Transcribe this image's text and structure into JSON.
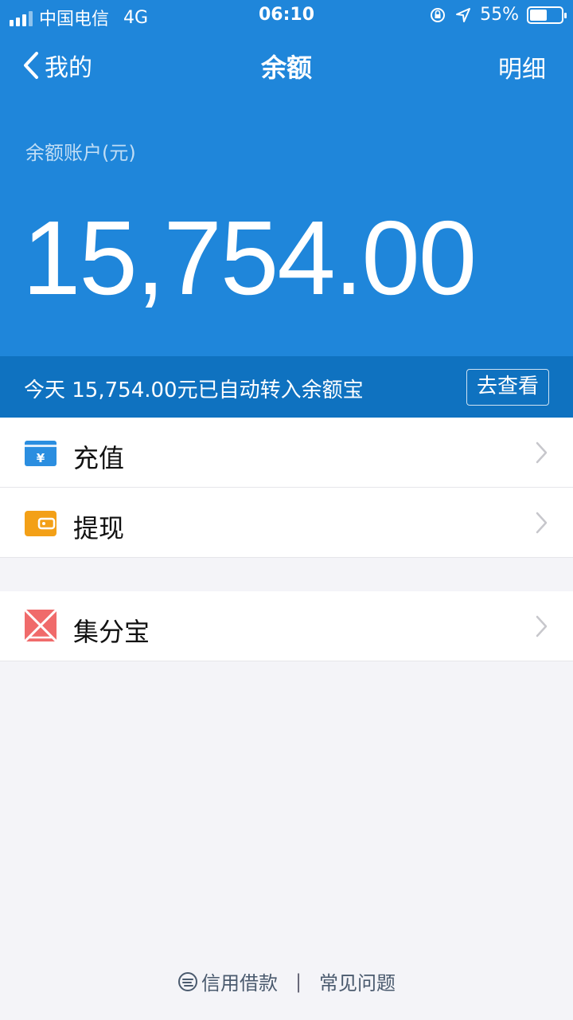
{
  "status": {
    "carrier": "中国电信",
    "network": "4G",
    "time": "06:10",
    "battery": "55%",
    "battery_level": 0.55
  },
  "nav": {
    "back_label": "我的",
    "title": "余额",
    "right_label": "明细"
  },
  "account": {
    "label": "余额账户(元)",
    "balance": "15,754.00"
  },
  "notice": {
    "text": "今天 15,754.00元已自动转入余额宝",
    "button": "去查看"
  },
  "list_group1": [
    {
      "label": "充值",
      "icon": "recharge-icon",
      "color": "#2b8ee0"
    },
    {
      "label": "提现",
      "icon": "withdraw-icon",
      "color": "#f3a017"
    }
  ],
  "list_group2": [
    {
      "label": "集分宝",
      "icon": "jifenbao-icon",
      "color": "#f06b6b"
    }
  ],
  "footer": {
    "link1": "信用借款",
    "link2": "常见问题"
  },
  "colors": {
    "header_blue": "#1f86da",
    "notice_blue": "#0f72c0",
    "background": "#f4f4f8"
  }
}
